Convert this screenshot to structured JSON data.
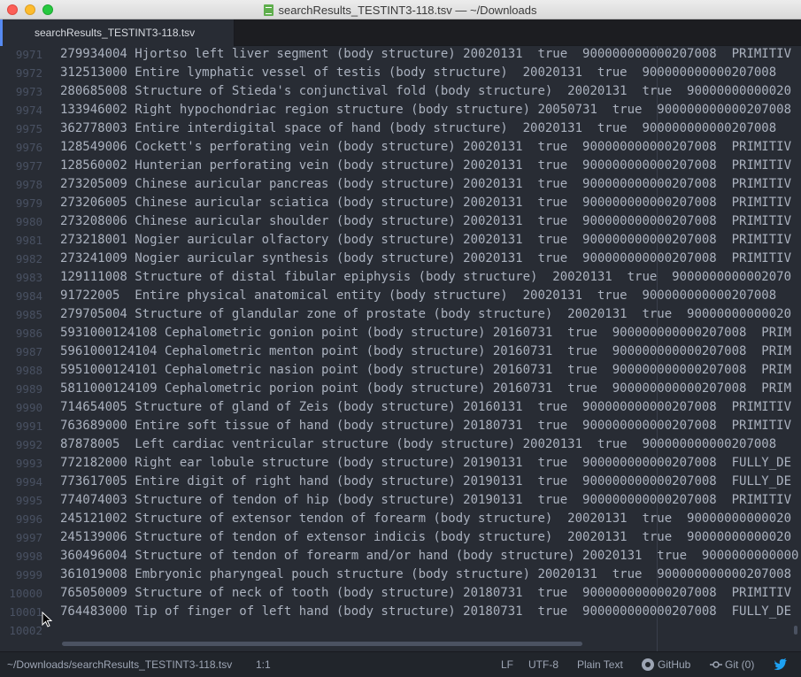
{
  "window": {
    "title": "searchResults_TESTINT3-118.tsv — ~/Downloads"
  },
  "tabs": [
    {
      "label": "searchResults_TESTINT3-118.tsv"
    }
  ],
  "editor": {
    "lines": [
      {
        "num": "9971",
        "text": "279934004 Hjortso left liver segment (body structure) 20020131  true  900000000000207008  PRIMITIV"
      },
      {
        "num": "9972",
        "text": "312513000 Entire lymphatic vessel of testis (body structure)  20020131  true  900000000000207008"
      },
      {
        "num": "9973",
        "text": "280685008 Structure of Stieda's conjunctival fold (body structure)  20020131  true  90000000000020"
      },
      {
        "num": "9974",
        "text": "133946002 Right hypochondriac region structure (body structure) 20050731  true  900000000000207008"
      },
      {
        "num": "9975",
        "text": "362778003 Entire interdigital space of hand (body structure)  20020131  true  900000000000207008"
      },
      {
        "num": "9976",
        "text": "128549006 Cockett's perforating vein (body structure) 20020131  true  900000000000207008  PRIMITIV"
      },
      {
        "num": "9977",
        "text": "128560002 Hunterian perforating vein (body structure) 20020131  true  900000000000207008  PRIMITIV"
      },
      {
        "num": "9978",
        "text": "273205009 Chinese auricular pancreas (body structure) 20020131  true  900000000000207008  PRIMITIV"
      },
      {
        "num": "9979",
        "text": "273206005 Chinese auricular sciatica (body structure) 20020131  true  900000000000207008  PRIMITIV"
      },
      {
        "num": "9980",
        "text": "273208006 Chinese auricular shoulder (body structure) 20020131  true  900000000000207008  PRIMITIV"
      },
      {
        "num": "9981",
        "text": "273218001 Nogier auricular olfactory (body structure) 20020131  true  900000000000207008  PRIMITIV"
      },
      {
        "num": "9982",
        "text": "273241009 Nogier auricular synthesis (body structure) 20020131  true  900000000000207008  PRIMITIV"
      },
      {
        "num": "9983",
        "text": "129111008 Structure of distal fibular epiphysis (body structure)  20020131  true  9000000000002070"
      },
      {
        "num": "9984",
        "text": "91722005  Entire physical anatomical entity (body structure)  20020131  true  900000000000207008"
      },
      {
        "num": "9985",
        "text": "279705004 Structure of glandular zone of prostate (body structure)  20020131  true  90000000000020"
      },
      {
        "num": "9986",
        "text": "5931000124108 Cephalometric gonion point (body structure) 20160731  true  900000000000207008  PRIM"
      },
      {
        "num": "9987",
        "text": "5961000124104 Cephalometric menton point (body structure) 20160731  true  900000000000207008  PRIM"
      },
      {
        "num": "9988",
        "text": "5951000124101 Cephalometric nasion point (body structure) 20160731  true  900000000000207008  PRIM"
      },
      {
        "num": "9989",
        "text": "5811000124109 Cephalometric porion point (body structure) 20160731  true  900000000000207008  PRIM"
      },
      {
        "num": "9990",
        "text": "714654005 Structure of gland of Zeis (body structure) 20160131  true  900000000000207008  PRIMITIV"
      },
      {
        "num": "9991",
        "text": "763689000 Entire soft tissue of hand (body structure) 20180731  true  900000000000207008  PRIMITIV"
      },
      {
        "num": "9992",
        "text": "87878005  Left cardiac ventricular structure (body structure) 20020131  true  900000000000207008"
      },
      {
        "num": "9993",
        "text": "772182000 Right ear lobule structure (body structure) 20190131  true  900000000000207008  FULLY_DE"
      },
      {
        "num": "9994",
        "text": "773617005 Entire digit of right hand (body structure) 20190131  true  900000000000207008  FULLY_DE"
      },
      {
        "num": "9995",
        "text": "774074003 Structure of tendon of hip (body structure) 20190131  true  900000000000207008  PRIMITIV"
      },
      {
        "num": "9996",
        "text": "245121002 Structure of extensor tendon of forearm (body structure)  20020131  true  90000000000020"
      },
      {
        "num": "9997",
        "text": "245139006 Structure of tendon of extensor indicis (body structure)  20020131  true  90000000000020"
      },
      {
        "num": "9998",
        "text": "360496004 Structure of tendon of forearm and/or hand (body structure) 20020131  true  9000000000000"
      },
      {
        "num": "9999",
        "text": "361019008 Embryonic pharyngeal pouch structure (body structure) 20020131  true  900000000000207008"
      },
      {
        "num": "10000",
        "text": "765050009 Structure of neck of tooth (body structure) 20180731  true  900000000000207008  PRIMITIV"
      },
      {
        "num": "10001",
        "text": "764483000 Tip of finger of left hand (body structure) 20180731  true  900000000000207008  FULLY_DE"
      },
      {
        "num": "10002",
        "text": ""
      }
    ]
  },
  "status": {
    "path": "~/Downloads/searchResults_TESTINT3-118.tsv",
    "cursor": "1:1",
    "line_ending": "LF",
    "encoding": "UTF-8",
    "grammar": "Plain Text",
    "github": "GitHub",
    "git": "Git (0)"
  },
  "colors": {
    "editor_bg": "#282c34",
    "text": "#abb2bf",
    "line_number": "#495162",
    "accent": "#568af2"
  }
}
